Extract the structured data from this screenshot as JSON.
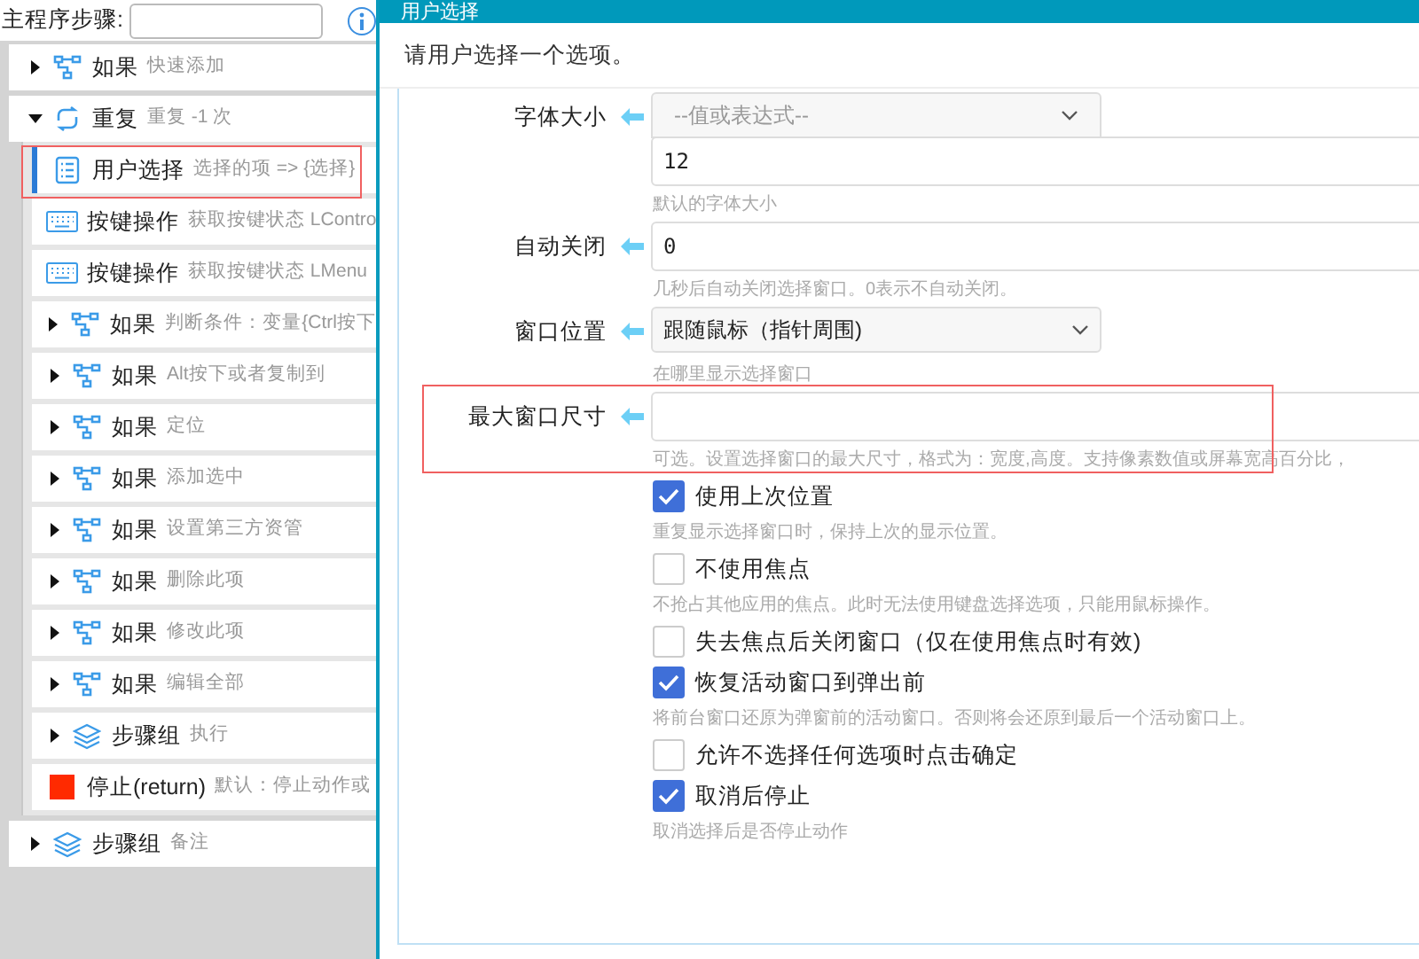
{
  "main": {
    "label": "主程序步骤:",
    "steps": [
      {
        "kind": "if",
        "name": "如果",
        "desc": "快速添加",
        "expanded": false,
        "selected": false
      },
      {
        "kind": "repeat",
        "name": "重复",
        "desc": "重复 -1 次",
        "expanded": true,
        "selected": false,
        "children": [
          {
            "kind": "choice",
            "name": "用户选择",
            "desc": "选择的项 => {选择}",
            "selected": true
          },
          {
            "kind": "key",
            "name": "按键操作",
            "desc": "获取按键状态 LContro",
            "selected": false
          },
          {
            "kind": "key",
            "name": "按键操作",
            "desc": "获取按键状态 LMenu",
            "selected": false
          },
          {
            "kind": "if",
            "name": "如果",
            "desc": "判断条件：变量{Ctrl按下",
            "expanded": false,
            "selected": false
          },
          {
            "kind": "if",
            "name": "如果",
            "desc": "Alt按下或者复制到",
            "expanded": false,
            "selected": false
          },
          {
            "kind": "if",
            "name": "如果",
            "desc": "定位",
            "expanded": false,
            "selected": false
          },
          {
            "kind": "if",
            "name": "如果",
            "desc": "添加选中",
            "expanded": false,
            "selected": false
          },
          {
            "kind": "if",
            "name": "如果",
            "desc": "设置第三方资管",
            "expanded": false,
            "selected": false
          },
          {
            "kind": "if",
            "name": "如果",
            "desc": "删除此项",
            "expanded": false,
            "selected": false
          },
          {
            "kind": "if",
            "name": "如果",
            "desc": "修改此项",
            "expanded": false,
            "selected": false
          },
          {
            "kind": "if",
            "name": "如果",
            "desc": "编辑全部",
            "expanded": false,
            "selected": false
          },
          {
            "kind": "group",
            "name": "步骤组",
            "desc": "执行",
            "expanded": false,
            "selected": false
          },
          {
            "kind": "stop",
            "name": "停止(return)",
            "desc": "默认：停止动作或",
            "selected": false
          }
        ]
      },
      {
        "kind": "group",
        "name": "步骤组",
        "desc": "备注",
        "expanded": false,
        "selected": false
      }
    ]
  },
  "dialog": {
    "title": "用户选择",
    "prompt": "请用户选择一个选项。",
    "fields": [
      {
        "kind": "select-input",
        "label": "字体大小",
        "placeholder": "--值或表达式--",
        "value": "12",
        "hint": "默认的字体大小"
      },
      {
        "kind": "input",
        "label": "自动关闭",
        "value": "0",
        "hint": "几秒后自动关闭选择窗口。0表示不自动关闭。"
      },
      {
        "kind": "select",
        "label": "窗口位置",
        "value": "跟随鼠标（指针周围)",
        "hint": "在哪里显示选择窗口"
      },
      {
        "kind": "input",
        "label": "最大窗口尺寸",
        "hint": "可选。设置选择窗口的最大尺寸，格式为：宽度,高度。支持像素数值或屏幕宽高百分比，"
      }
    ],
    "options": [
      {
        "label": "使用上次位置",
        "checked": true,
        "hint": "重复显示选择窗口时，保持上次的显示位置。"
      },
      {
        "label": "不使用焦点",
        "checked": false,
        "hint": "不抢占其他应用的焦点。此时无法使用键盘选择选项，只能用鼠标操作。"
      },
      {
        "label": "失去焦点后关闭窗口（仅在使用焦点时有效)",
        "checked": false
      },
      {
        "label": "恢复活动窗口到弹出前",
        "checked": true,
        "hint": "将前台窗口还原为弹窗前的活动窗口。否则将会还原到最后一个活动窗口上。"
      },
      {
        "label": "允许不选择任何选项时点击确定",
        "checked": false
      },
      {
        "label": "取消后停止",
        "checked": true,
        "hint": "取消选择后是否停止动作"
      }
    ]
  }
}
